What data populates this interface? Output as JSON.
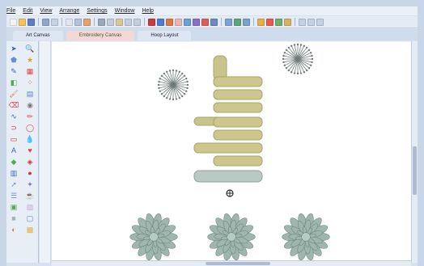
{
  "menu": {
    "items": [
      "File",
      "Edit",
      "View",
      "Arrange",
      "Settings",
      "Window",
      "Help"
    ]
  },
  "tabs": [
    {
      "label": "Art Canvas",
      "active": false
    },
    {
      "label": "Embroidery Canvas",
      "active": true
    },
    {
      "label": "Hoop Layout",
      "active": false
    }
  ],
  "canvas": {
    "lettering": "faith",
    "colors": {
      "gold_thread": "#c9c48a",
      "silver_thread": "#9fb6ae",
      "burst_thread": "#6f7b79"
    }
  },
  "icons": {
    "palette_tools": [
      "select-arrow-icon",
      "zoom-icon",
      "polygon-icon",
      "star-icon",
      "pen-icon",
      "grid-icon",
      "fill-icon",
      "dots-icon",
      "brush-icon",
      "table-icon",
      "eraser-icon",
      "stamp-icon",
      "curve-icon",
      "pencil-icon",
      "magnet-icon",
      "circle-icon",
      "rectangle-icon",
      "paint-drop-icon",
      "text-icon",
      "heart-icon",
      "shape-icon",
      "gem-icon",
      "chart-icon",
      "apple-icon",
      "arrow-icon",
      "wand-icon",
      "layers-icon",
      "cup-icon",
      "photo-icon",
      "gradient-icon",
      "block-icon",
      "rounded-box-icon",
      "palette-icon",
      "color-swatch-icon"
    ]
  }
}
